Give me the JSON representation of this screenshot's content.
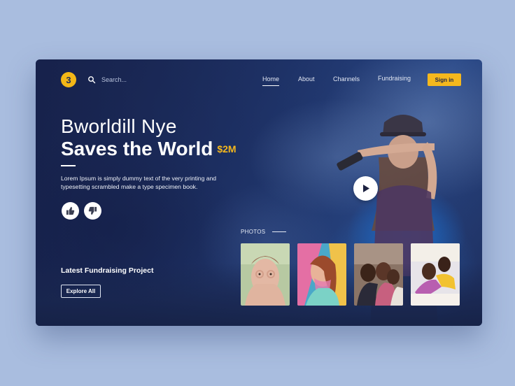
{
  "nav": {
    "logo_glyph": "3",
    "search_placeholder": "Search...",
    "links": [
      {
        "label": "Home",
        "active": true
      },
      {
        "label": "About",
        "active": false
      },
      {
        "label": "Channels",
        "active": false
      },
      {
        "label": "Fundraising",
        "active": false
      }
    ],
    "signin_label": "Sign in"
  },
  "hero": {
    "subtitle": "Bworldill Nye",
    "title": "Saves the World",
    "amount": "$2M",
    "description": "Lorem Ipsum is simply dummy text of the very  printing and typesetting scrambled make a type specimen book."
  },
  "votes": {
    "up_icon": "thumbs-up-icon",
    "down_icon": "thumbs-down-icon"
  },
  "video": {
    "play_icon": "play-icon"
  },
  "photos": {
    "label": "PHOTOS"
  },
  "fundraising": {
    "heading": "Latest Fundraising Project",
    "button_label": "Explore All"
  },
  "colors": {
    "accent": "#f5b81d",
    "background": "#a9bddf",
    "card": "#223a74"
  }
}
